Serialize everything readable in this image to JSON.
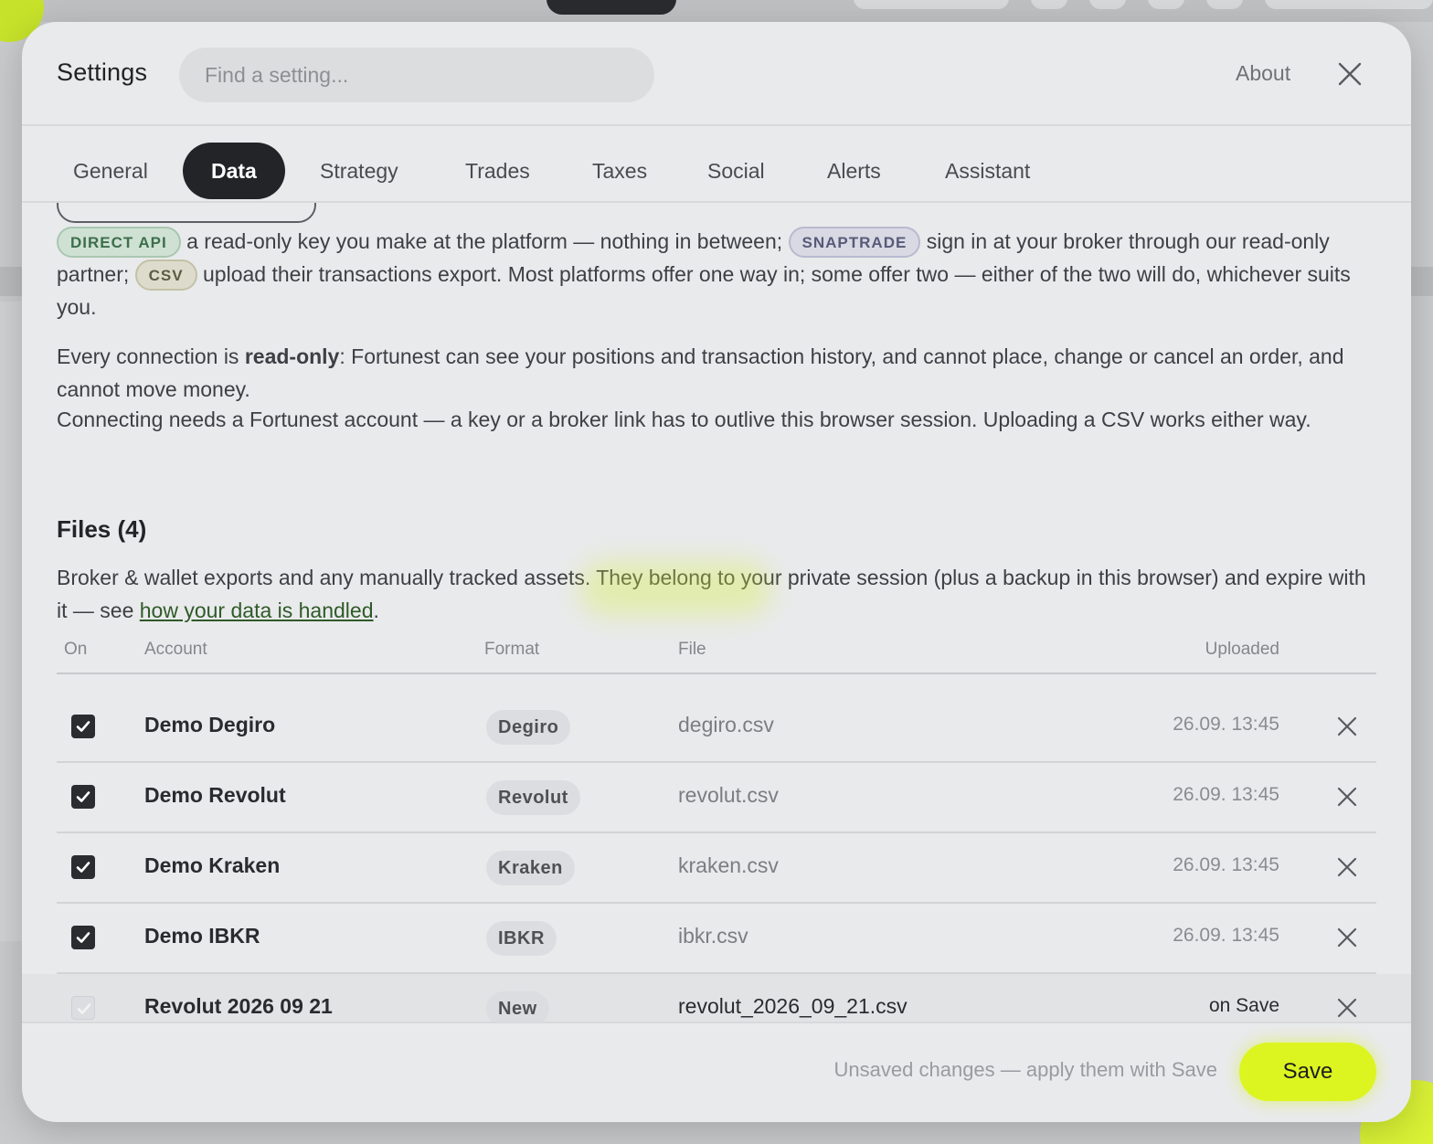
{
  "modal": {
    "title": "Settings",
    "search_placeholder": "Find a setting...",
    "about_label": "About",
    "close_icon": "close-icon"
  },
  "tabs": [
    {
      "label": "General",
      "active": false
    },
    {
      "label": "Data",
      "active": true
    },
    {
      "label": "Strategy",
      "active": false
    },
    {
      "label": "Trades",
      "active": false
    },
    {
      "label": "Taxes",
      "active": false
    },
    {
      "label": "Social",
      "active": false
    },
    {
      "label": "Alerts",
      "active": false
    },
    {
      "label": "Assistant",
      "active": false
    }
  ],
  "intro": {
    "badge_api": "DIRECT API",
    "text_api": "a read-only key you make at the platform — nothing in between;",
    "badge_snap": "SNAPTRADE",
    "text_snap": "sign in at your broker through our read-only partner;",
    "badge_csv": "CSV",
    "text_csv": "upload their transactions export. Most platforms offer one way in; some offer two — either of the two will do, whichever suits you.",
    "readonly_pre": "Every connection is",
    "readonly_bold": "read-only",
    "readonly_post": ": Fortunest can see your positions and transaction history, and cannot place, change or cancel an order, and cannot move money.",
    "account_note": "Connecting needs a Fortunest account — a key or a broker link has to outlive this browser session. Uploading a CSV works either way."
  },
  "files": {
    "heading": "Files (4)",
    "desc_pre": "Broker & wallet exports and any manually tracked assets. They belong to your private session (plus a backup in this browser) and expire with it — see",
    "desc_link": "how your data is handled",
    "desc_post": ".",
    "columns": {
      "on": "On",
      "account": "Account",
      "format": "Format",
      "file": "File",
      "uploaded": "Uploaded"
    },
    "rows": [
      {
        "checked": true,
        "account": "Demo Degiro",
        "format": "Degiro",
        "file": "degiro.csv",
        "uploaded": "26.09. 13:45"
      },
      {
        "checked": true,
        "account": "Demo Revolut",
        "format": "Revolut",
        "file": "revolut.csv",
        "uploaded": "26.09. 13:45"
      },
      {
        "checked": true,
        "account": "Demo Kraken",
        "format": "Kraken",
        "file": "kraken.csv",
        "uploaded": "26.09. 13:45"
      },
      {
        "checked": true,
        "account": "Demo IBKR",
        "format": "IBKR",
        "file": "ibkr.csv",
        "uploaded": "26.09. 13:45"
      },
      {
        "checked": true,
        "disabled": true,
        "account": "Revolut 2026 09 21",
        "format": "New",
        "file": "revolut_2026_09_21.csv",
        "uploaded": "on Save"
      }
    ]
  },
  "footer": {
    "unsaved_text": "Unsaved changes — apply them with Save",
    "save_label": "Save"
  },
  "colors": {
    "accent": "#dcf521",
    "active_tab": "#232427",
    "modal_bg": "#e9eaec"
  }
}
